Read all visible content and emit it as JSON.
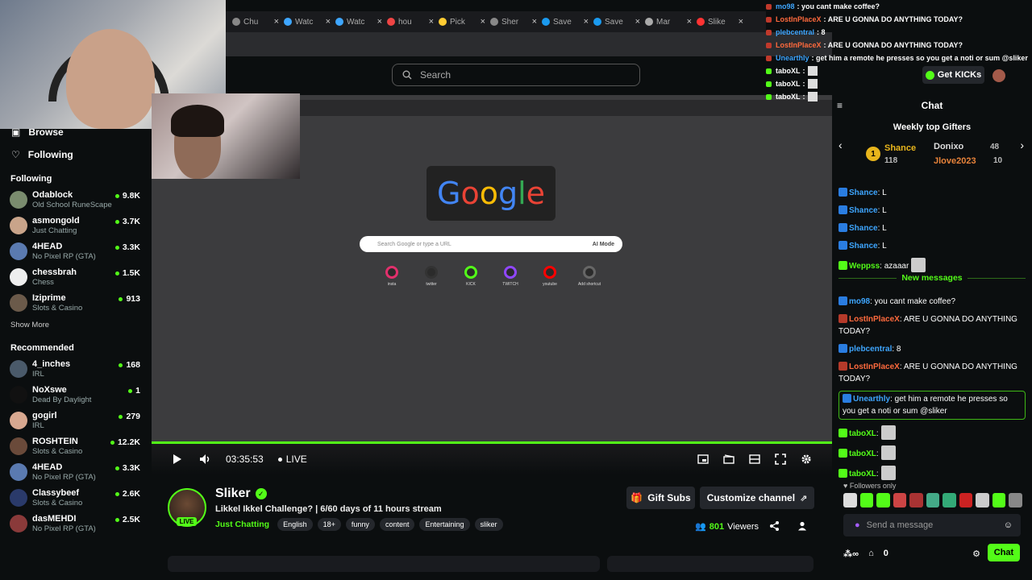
{
  "browser": {
    "tabs": [
      {
        "label": "Chu",
        "color": "#888"
      },
      {
        "label": "Watc",
        "color": "#3ea6ff"
      },
      {
        "label": "Watc",
        "color": "#3ea6ff"
      },
      {
        "label": "hou",
        "color": "#e44"
      },
      {
        "label": "Pick",
        "color": "#ffcc33"
      },
      {
        "label": "Sher",
        "color": "#888"
      },
      {
        "label": "Save",
        "color": "#1b9aef"
      },
      {
        "label": "Save",
        "color": "#1b9aef"
      },
      {
        "label": "Mar",
        "color": "#aaa"
      },
      {
        "label": "Slike",
        "color": "#ff3333"
      }
    ]
  },
  "search": {
    "placeholder": "Search"
  },
  "sidebar": {
    "nav": [
      {
        "label": "Browse",
        "icon": "browse-icon"
      },
      {
        "label": "Following",
        "icon": "heart-icon"
      }
    ],
    "following_title": "Following",
    "following": [
      {
        "name": "Odablock",
        "category": "Old School RuneScape",
        "viewers": "9.8K",
        "color": "#7a8c6e"
      },
      {
        "name": "asmongold",
        "category": "Just Chatting",
        "viewers": "3.7K",
        "color": "#c9a48a"
      },
      {
        "name": "4HEAD",
        "category": "No Pixel RP (GTA)",
        "viewers": "3.3K",
        "color": "#5a7ab0"
      },
      {
        "name": "chessbrah",
        "category": "Chess",
        "viewers": "1.5K",
        "color": "#eeeeee"
      },
      {
        "name": "Iziprime",
        "category": "Slots & Casino",
        "viewers": "913",
        "color": "#6b5a4a"
      }
    ],
    "show_more": "Show More",
    "recommended_title": "Recommended",
    "recommended": [
      {
        "name": "4_inches",
        "category": "IRL",
        "viewers": "168",
        "color": "#4a5a6a"
      },
      {
        "name": "NoXswe",
        "category": "Dead By Daylight",
        "viewers": "1",
        "color": "#111111"
      },
      {
        "name": "gogirl",
        "category": "IRL",
        "viewers": "279",
        "color": "#d8a890"
      },
      {
        "name": "ROSHTEIN",
        "category": "Slots & Casino",
        "viewers": "12.2K",
        "color": "#6a4a3a"
      },
      {
        "name": "4HEAD",
        "category": "No Pixel RP (GTA)",
        "viewers": "3.3K",
        "color": "#5a7ab0"
      },
      {
        "name": "Classybeef",
        "category": "Slots & Casino",
        "viewers": "2.6K",
        "color": "#2a3a6a"
      },
      {
        "name": "dasMEHDI",
        "category": "No Pixel RP (GTA)",
        "viewers": "2.5K",
        "color": "#8a3a3a"
      }
    ]
  },
  "video": {
    "google_search_placeholder": "Search Google or type a URL",
    "ai_mode": "AI Mode",
    "shortcuts": [
      "insta",
      "twitter",
      "KICK",
      "TWITCH",
      "youtube",
      "Add shortcut"
    ],
    "time": "03:35:53",
    "live": "LIVE"
  },
  "stream": {
    "name": "Sliker",
    "live_badge": "LIVE",
    "title": "Likkel Ikkel Challenge? | 6/60 days of 11 hours stream",
    "category": "Just Chatting",
    "tags": [
      "English",
      "18+",
      "funny",
      "content",
      "Entertaining",
      "sliker"
    ],
    "gift_subs": "Gift Subs",
    "customize": "Customize channel",
    "viewers": "801",
    "viewers_label": "Viewers"
  },
  "overlay_chat": [
    {
      "user": "mo98",
      "text": ": you cant make coffee?"
    },
    {
      "user": "LostInPlaceX",
      "text": ": ARE U GONNA DO ANYTHING TODAY?"
    },
    {
      "user": "plebcentral",
      "text": ": 8"
    },
    {
      "user": "LostInPlaceX",
      "text": ": ARE U GONNA DO ANYTHING TODAY?"
    },
    {
      "user": "Unearthly",
      "text": ": get him a remote he presses so you get a noti or sum @sliker"
    },
    {
      "user": "taboXL",
      "text": ":"
    },
    {
      "user": "taboXL",
      "text": ":"
    },
    {
      "user": "taboXL",
      "text": ":"
    }
  ],
  "chat": {
    "get_kicks": "Get KICKs",
    "title": "Chat",
    "weekly_title": "Weekly top Gifters",
    "gifters": [
      {
        "name": "Shance",
        "count": "118"
      },
      {
        "name": "Donixo",
        "count": "48"
      },
      {
        "name": "Jlove2023",
        "count": "10"
      }
    ],
    "messages_before": [
      {
        "user": "Shance",
        "text": ": L",
        "color": "#3ea6ff"
      },
      {
        "user": "Shance",
        "text": ": L",
        "color": "#3ea6ff"
      },
      {
        "user": "Shance",
        "text": ": L",
        "color": "#3ea6ff"
      },
      {
        "user": "Shance",
        "text": ": L",
        "color": "#3ea6ff"
      },
      {
        "user": "Weppss",
        "text": ": azaaar",
        "color": "#53fc18"
      }
    ],
    "new_messages": "New messages",
    "messages_after": [
      {
        "user": "mo98",
        "text": ": you cant make coffee?",
        "color": "#3ea6ff"
      },
      {
        "user": "LostInPlaceX",
        "text": ": ARE U GONNA DO ANYTHING TODAY?",
        "color": "#ff6a3d"
      },
      {
        "user": "plebcentral",
        "text": ": 8",
        "color": "#3ea6ff"
      },
      {
        "user": "LostInPlaceX",
        "text": ": ARE U GONNA DO ANYTHING TODAY?",
        "color": "#ff6a3d"
      },
      {
        "user": "Unearthly",
        "text": ": get him a remote he presses so you get a noti or sum @sliker",
        "color": "#3ea6ff"
      },
      {
        "user": "taboXL",
        "text": ":",
        "color": "#53fc18"
      },
      {
        "user": "taboXL",
        "text": ":",
        "color": "#53fc18"
      },
      {
        "user": "taboXL",
        "text": ":",
        "color": "#53fc18"
      }
    ],
    "followers_only": "Followers only",
    "send_placeholder": "Send a message",
    "kick_count": "0",
    "chat_button": "Chat"
  }
}
